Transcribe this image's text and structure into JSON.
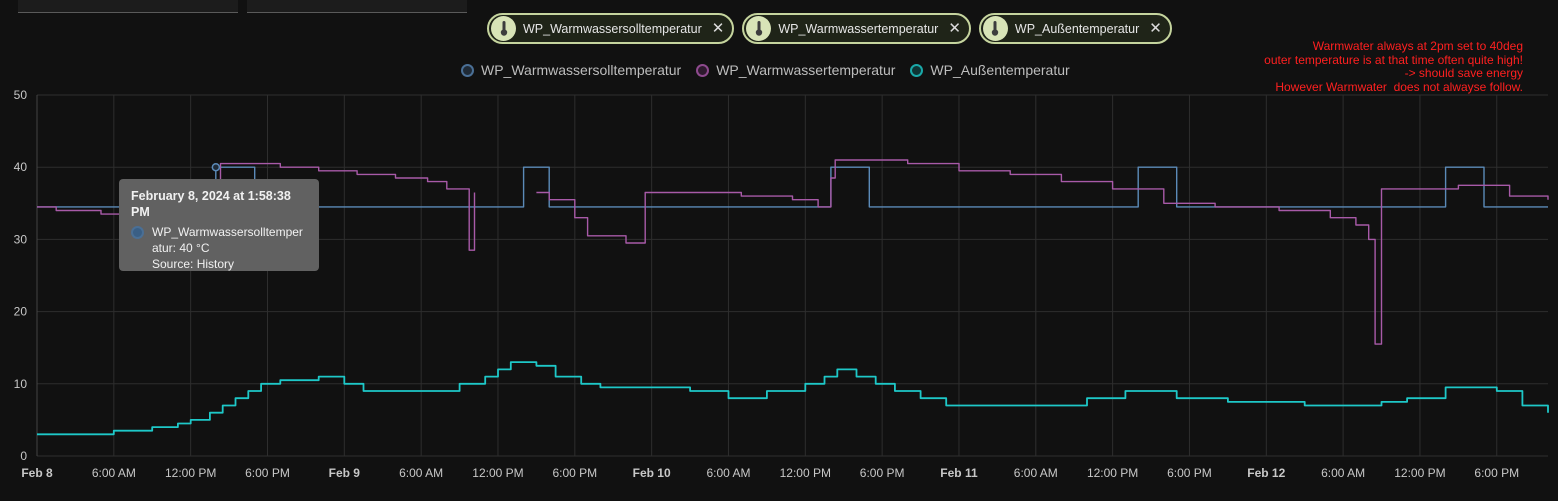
{
  "chips": [
    {
      "label": "WP_Warmwassersolltemperatur",
      "icon": "thermometer-icon",
      "close": "✕"
    },
    {
      "label": "WP_Warmwassertemperatur",
      "icon": "thermometer-icon",
      "close": "✕"
    },
    {
      "label": "WP_Außentemperatur",
      "icon": "thermometer-icon",
      "close": "✕"
    }
  ],
  "annotation": [
    "Warmwater always at 2pm set to 40deg",
    "outer temperature is at that time often quite high!",
    "-> should save energy",
    "",
    "However Warmwater  does not alwayse follow."
  ],
  "annotation_color": "#ff2020",
  "tooltip": {
    "title": "February 8, 2024 at 1:58:38 PM",
    "series": "WP_Warmwassersolltemper",
    "value": "atur: 40 °C",
    "source": "Source: History"
  },
  "chart_data": {
    "type": "line",
    "x_range": [
      "2024-02-08T00:00",
      "2024-02-12T22:00"
    ],
    "ylim": [
      0,
      50
    ],
    "yticks": [
      0,
      10,
      20,
      30,
      40,
      50
    ],
    "grid": true,
    "legend_position": "top-center",
    "xticks": [
      {
        "t": "2024-02-08T00:00",
        "label": "Feb 8",
        "bold": true
      },
      {
        "t": "2024-02-08T06:00",
        "label": "6:00 AM"
      },
      {
        "t": "2024-02-08T12:00",
        "label": "12:00 PM"
      },
      {
        "t": "2024-02-08T18:00",
        "label": "6:00 PM"
      },
      {
        "t": "2024-02-09T00:00",
        "label": "Feb 9",
        "bold": true
      },
      {
        "t": "2024-02-09T06:00",
        "label": "6:00 AM"
      },
      {
        "t": "2024-02-09T12:00",
        "label": "12:00 PM"
      },
      {
        "t": "2024-02-09T18:00",
        "label": "6:00 PM"
      },
      {
        "t": "2024-02-10T00:00",
        "label": "Feb 10",
        "bold": true
      },
      {
        "t": "2024-02-10T06:00",
        "label": "6:00 AM"
      },
      {
        "t": "2024-02-10T12:00",
        "label": "12:00 PM"
      },
      {
        "t": "2024-02-10T18:00",
        "label": "6:00 PM"
      },
      {
        "t": "2024-02-11T00:00",
        "label": "Feb 11",
        "bold": true
      },
      {
        "t": "2024-02-11T06:00",
        "label": "6:00 AM"
      },
      {
        "t": "2024-02-11T12:00",
        "label": "12:00 PM"
      },
      {
        "t": "2024-02-11T18:00",
        "label": "6:00 PM"
      },
      {
        "t": "2024-02-12T00:00",
        "label": "Feb 12",
        "bold": true
      },
      {
        "t": "2024-02-12T06:00",
        "label": "6:00 AM"
      },
      {
        "t": "2024-02-12T12:00",
        "label": "12:00 PM"
      },
      {
        "t": "2024-02-12T18:00",
        "label": "6:00 PM"
      }
    ],
    "series": [
      {
        "name": "WP_Warmwassersolltemperatur",
        "color": "#5b8ab8",
        "step": true,
        "points": [
          [
            "2024-02-08T00:00",
            34.5
          ],
          [
            "2024-02-08T13:58",
            40
          ],
          [
            "2024-02-08T17:00",
            34.5
          ],
          [
            "2024-02-09T14:00",
            40
          ],
          [
            "2024-02-09T16:00",
            34.5
          ],
          [
            "2024-02-10T14:00",
            40
          ],
          [
            "2024-02-10T17:00",
            34.5
          ],
          [
            "2024-02-11T14:00",
            40
          ],
          [
            "2024-02-11T17:00",
            34.5
          ],
          [
            "2024-02-12T14:00",
            40
          ],
          [
            "2024-02-12T17:00",
            34.5
          ],
          [
            "2024-02-12T22:00",
            34.5
          ]
        ]
      },
      {
        "name": "WP_Warmwassertemperatur",
        "color": "#a85aa8",
        "step": true,
        "points": [
          [
            "2024-02-08T00:00",
            34.5
          ],
          [
            "2024-02-08T01:30",
            34
          ],
          [
            "2024-02-08T05:00",
            33.5
          ],
          [
            "2024-02-08T09:30",
            34
          ],
          [
            "2024-02-08T13:58",
            38
          ],
          [
            "2024-02-08T14:20",
            40.5
          ],
          [
            "2024-02-08T19:00",
            40
          ],
          [
            "2024-02-08T22:00",
            39.5
          ],
          [
            "2024-02-09T01:00",
            39
          ],
          [
            "2024-02-09T04:00",
            38.5
          ],
          [
            "2024-02-09T06:30",
            38
          ],
          [
            "2024-02-09T08:00",
            37
          ],
          [
            "2024-02-09T09:20",
            37
          ],
          [
            "2024-02-09T09:45",
            28.5
          ],
          [
            "2024-02-09T10:10",
            36.5
          ],
          [
            "2024-02-09T14:00",
            null
          ],
          [
            "2024-02-09T15:00",
            36.5
          ],
          [
            "2024-02-09T16:00",
            35.5
          ],
          [
            "2024-02-09T18:00",
            33
          ],
          [
            "2024-02-09T19:00",
            30.5
          ],
          [
            "2024-02-09T22:00",
            29.5
          ],
          [
            "2024-02-09T23:00",
            29.5
          ],
          [
            "2024-02-09T23:30",
            36.5
          ],
          [
            "2024-02-10T07:00",
            36
          ],
          [
            "2024-02-10T11:00",
            35.5
          ],
          [
            "2024-02-10T13:00",
            34.5
          ],
          [
            "2024-02-10T14:00",
            38.5
          ],
          [
            "2024-02-10T14:20",
            41
          ],
          [
            "2024-02-10T20:00",
            40.5
          ],
          [
            "2024-02-11T00:00",
            39.5
          ],
          [
            "2024-02-11T04:00",
            39
          ],
          [
            "2024-02-11T08:00",
            38
          ],
          [
            "2024-02-11T12:00",
            37
          ],
          [
            "2024-02-11T16:00",
            35
          ],
          [
            "2024-02-11T20:00",
            34.5
          ],
          [
            "2024-02-12T01:00",
            34
          ],
          [
            "2024-02-12T05:00",
            33
          ],
          [
            "2024-02-12T07:00",
            32
          ],
          [
            "2024-02-12T08:00",
            30
          ],
          [
            "2024-02-12T08:30",
            15.5
          ],
          [
            "2024-02-12T09:00",
            37
          ],
          [
            "2024-02-12T15:00",
            37.5
          ],
          [
            "2024-02-12T19:00",
            36
          ],
          [
            "2024-02-12T22:00",
            35.5
          ]
        ]
      },
      {
        "name": "WP_Außentemperatur",
        "color": "#1ec8c8",
        "step": true,
        "points": [
          [
            "2024-02-08T00:00",
            3
          ],
          [
            "2024-02-08T03:30",
            3
          ],
          [
            "2024-02-08T06:00",
            3.5
          ],
          [
            "2024-02-08T09:00",
            4
          ],
          [
            "2024-02-08T11:00",
            4.5
          ],
          [
            "2024-02-08T12:00",
            5
          ],
          [
            "2024-02-08T13:30",
            6
          ],
          [
            "2024-02-08T14:30",
            7
          ],
          [
            "2024-02-08T15:30",
            8
          ],
          [
            "2024-02-08T16:30",
            9
          ],
          [
            "2024-02-08T17:30",
            10
          ],
          [
            "2024-02-08T19:00",
            10.5
          ],
          [
            "2024-02-08T22:00",
            11
          ],
          [
            "2024-02-09T00:00",
            10
          ],
          [
            "2024-02-09T01:30",
            9
          ],
          [
            "2024-02-09T06:00",
            9
          ],
          [
            "2024-02-09T09:00",
            10
          ],
          [
            "2024-02-09T11:00",
            11
          ],
          [
            "2024-02-09T12:00",
            12
          ],
          [
            "2024-02-09T13:00",
            13
          ],
          [
            "2024-02-09T15:00",
            12.5
          ],
          [
            "2024-02-09T16:30",
            11
          ],
          [
            "2024-02-09T18:30",
            10
          ],
          [
            "2024-02-09T20:00",
            9.5
          ],
          [
            "2024-02-10T00:00",
            9.5
          ],
          [
            "2024-02-10T03:00",
            9
          ],
          [
            "2024-02-10T06:00",
            8
          ],
          [
            "2024-02-10T09:00",
            9
          ],
          [
            "2024-02-10T12:00",
            10
          ],
          [
            "2024-02-10T13:30",
            11
          ],
          [
            "2024-02-10T14:30",
            12
          ],
          [
            "2024-02-10T16:00",
            11
          ],
          [
            "2024-02-10T17:30",
            10
          ],
          [
            "2024-02-10T19:00",
            9
          ],
          [
            "2024-02-10T21:00",
            8
          ],
          [
            "2024-02-10T23:00",
            7
          ],
          [
            "2024-02-11T06:00",
            7
          ],
          [
            "2024-02-11T10:00",
            8
          ],
          [
            "2024-02-11T13:00",
            9
          ],
          [
            "2024-02-11T17:00",
            8
          ],
          [
            "2024-02-11T21:00",
            7.5
          ],
          [
            "2024-02-12T03:00",
            7
          ],
          [
            "2024-02-12T09:00",
            7.5
          ],
          [
            "2024-02-12T11:00",
            8
          ],
          [
            "2024-02-12T14:00",
            9.5
          ],
          [
            "2024-02-12T18:00",
            9
          ],
          [
            "2024-02-12T20:00",
            7
          ],
          [
            "2024-02-12T22:00",
            6
          ]
        ]
      }
    ]
  }
}
